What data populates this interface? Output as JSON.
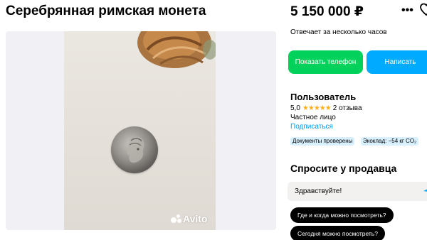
{
  "listing": {
    "title": "Серебрянная римская монета",
    "price": "5 150 000 ₽"
  },
  "gallery": {
    "watermark": "Avito"
  },
  "contact": {
    "response_time": "Отвечает за несколько часов",
    "show_phone_label": "Показать телефон",
    "write_label": "Написать"
  },
  "seller": {
    "name": "Пользователь",
    "rating": "5,0",
    "stars": "★★★★★",
    "reviews": "2 отзыва",
    "type": "Частное лицо",
    "subscribe_label": "Подписаться",
    "badges": [
      "Документы проверены",
      "Экоклад: −54 кг CO₂"
    ]
  },
  "ask": {
    "title": "Спросите у продавца",
    "input_value": "Здравствуйте!",
    "quick_questions": [
      "Где и когда можно посмотреть?",
      "Сегодня можно посмотреть?"
    ]
  },
  "icons": {
    "more": "more-dots-icon",
    "favorite": "heart-icon",
    "send": "send-icon"
  },
  "colors": {
    "phone_button": "#02d15c",
    "write_button": "#00aaff",
    "link": "#009cf0",
    "badge_bg": "#d9f1ff",
    "star": "#ffb021",
    "chip_bg": "#000000"
  }
}
